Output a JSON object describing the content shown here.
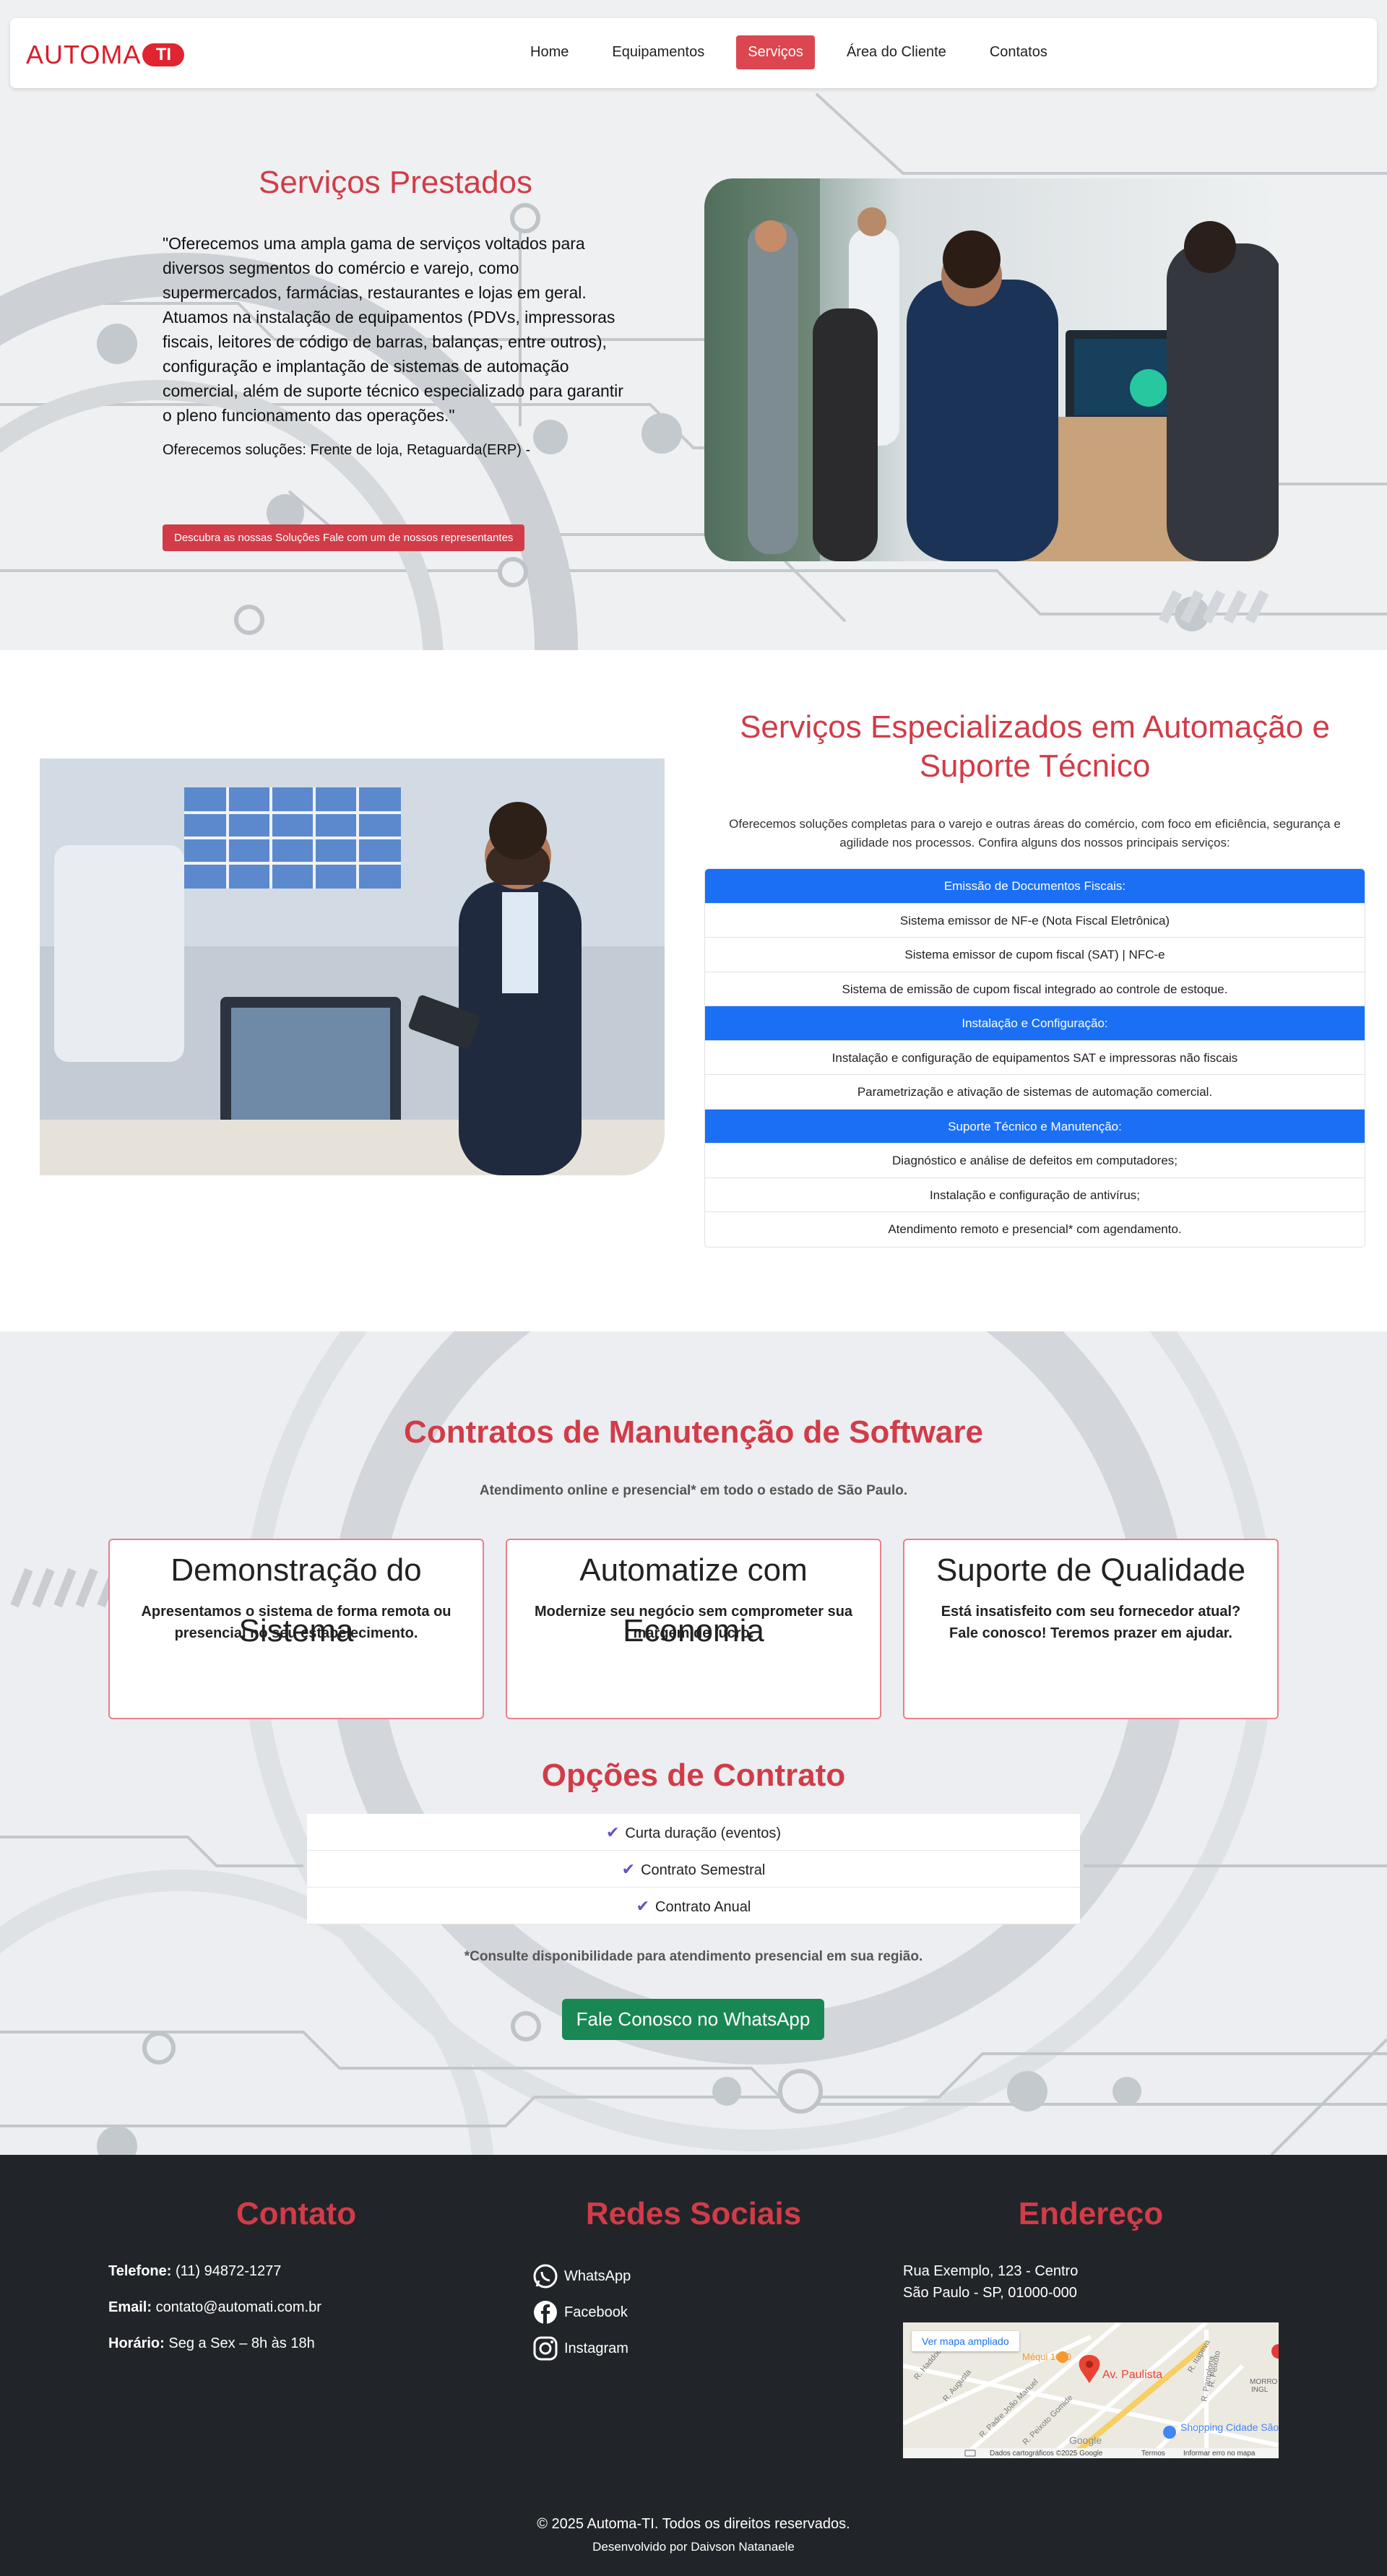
{
  "nav": {
    "logo_text": "AUTOMA",
    "logo_badge": "TI",
    "items": [
      {
        "label": "Home",
        "active": false
      },
      {
        "label": "Equipamentos",
        "active": false
      },
      {
        "label": "Serviços",
        "active": true
      },
      {
        "label": "Área do Cliente",
        "active": false
      },
      {
        "label": "Contatos",
        "active": false
      }
    ]
  },
  "hero": {
    "title": "Serviços Prestados",
    "description": "\"Oferecemos uma ampla gama de serviços voltados para diversos segmentos do comércio e varejo, como supermercados, farmácias, restaurantes e lojas em geral. Atuamos na instalação de equipamentos (PDVs, impressoras fiscais, leitores de código de barras, balanças, entre outros), configuração e implantação de sistemas de automação comercial, além de suporte técnico especializado para garantir o pleno funcionamento das operações.\"",
    "solutions": "Oferecemos soluções: Frente de loja, Retaguarda(ERP) -",
    "cta": "Descubra as nossas Soluções Fale com um de nossos representantes"
  },
  "specialized": {
    "title": "Serviços Especializados em Automação e Suporte Técnico",
    "intro": "Oferecemos soluções completas para o varejo e outras áreas do comércio, com foco em eficiência, segurança e agilidade nos processos. Confira alguns dos nossos principais serviços:",
    "items": [
      {
        "text": "Emissão de Documentos Fiscais:",
        "header": true
      },
      {
        "text": "Sistema emissor de NF-e (Nota Fiscal Eletrônica)",
        "header": false
      },
      {
        "text": "Sistema emissor de cupom fiscal (SAT) | NFC-e",
        "header": false
      },
      {
        "text": "Sistema de emissão de cupom fiscal integrado ao controle de estoque.",
        "header": false
      },
      {
        "text": "Instalação e Configuração:",
        "header": true
      },
      {
        "text": "Instalação e configuração de equipamentos SAT e impressoras não fiscais",
        "header": false
      },
      {
        "text": "Parametrização e ativação de sistemas de automação comercial.",
        "header": false
      },
      {
        "text": "Suporte Técnico e Manutenção:",
        "header": true
      },
      {
        "text": "Diagnóstico e análise de defeitos em computadores;",
        "header": false
      },
      {
        "text": "Instalação e configuração de antivírus;",
        "header": false
      },
      {
        "text": "Atendimento remoto e presencial* com agendamento.",
        "header": false
      }
    ],
    "colors": {
      "header_bg": "#1a6ff5"
    }
  },
  "contracts": {
    "title": "Contratos de Manutenção de Software",
    "subtitle": "Atendimento online e presencial* em todo o estado de São Paulo.",
    "cards": [
      {
        "title": "Demonstração do Sistema",
        "text": "Apresentamos o sistema de forma remota ou presencial no seu estabelecimento."
      },
      {
        "title": "Automatize com Economia",
        "text": "Modernize seu negócio sem comprometer sua margem de lucro."
      },
      {
        "title": "Suporte de Qualidade",
        "text": "Está insatisfeito com seu fornecedor atual? Fale conosco! Teremos prazer em ajudar."
      }
    ],
    "options_title": "Opções de Contrato",
    "options": [
      "Curta duração (eventos)",
      "Contrato Semestral",
      "Contrato Anual"
    ],
    "note": "*Consulte disponibilidade para atendimento presencial em sua região.",
    "whatsapp_button": "Fale Conosco no WhatsApp"
  },
  "footer": {
    "contact_title": "Contato",
    "phone_label": "Telefone:",
    "phone": "(11) 94872-1277",
    "email_label": "Email:",
    "email": "contato@automati.com.br",
    "hours_label": "Horário:",
    "hours": "Seg a Sex – 8h às 18h",
    "social_title": "Redes Sociais",
    "socials": [
      {
        "label": "WhatsApp",
        "icon": "whatsapp-icon"
      },
      {
        "label": "Facebook",
        "icon": "facebook-icon"
      },
      {
        "label": "Instagram",
        "icon": "instagram-icon"
      }
    ],
    "address_title": "Endereço",
    "address_line1": "Rua Exemplo, 123 - Centro",
    "address_line2": "São Paulo - SP, 01000-000",
    "map": {
      "link": "Ver mapa ampliado",
      "place": "Av. Paulista",
      "credits": "Dados cartográficos ©2025 Google",
      "terms": "Termos",
      "report": "Informar erro no mapa",
      "poi": "Shopping Cidade São Paulo",
      "logo": "Google"
    },
    "copyright": "© 2025 Automa-TI. Todos os direitos reservados.",
    "developer": "Desenvolvido por Daivson Natanaele"
  },
  "colors": {
    "accent": "#d13c48",
    "whatsapp_green": "#198754",
    "footer_bg": "#212529"
  }
}
